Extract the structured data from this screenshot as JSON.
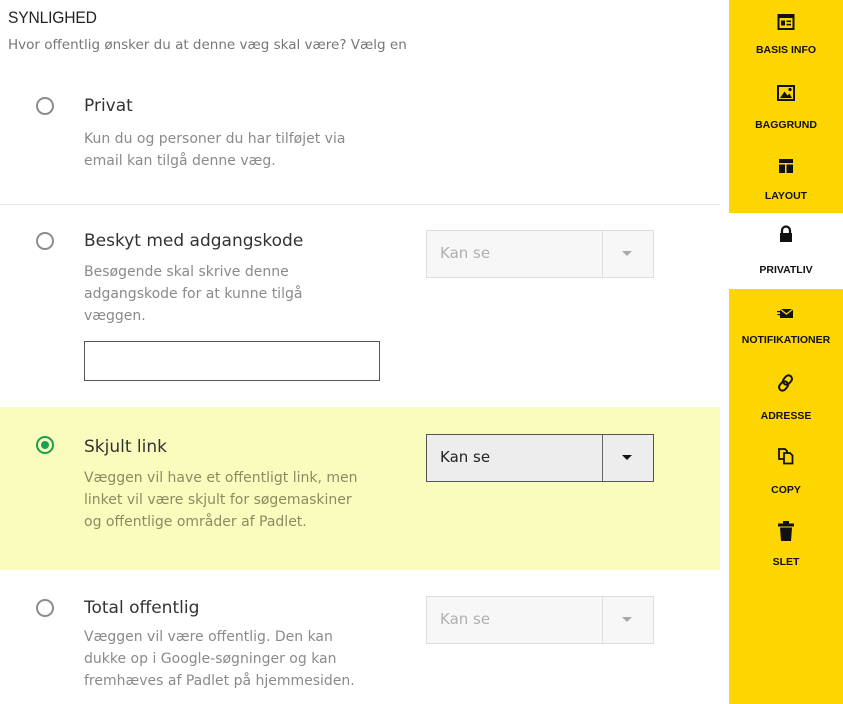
{
  "header": {
    "title": "SYNLIGHED",
    "subtitle": "Hvor offentlig ønsker du at denne væg skal være? Vælg en"
  },
  "options": [
    {
      "title": "Privat",
      "description": [
        "Kun du og personer du har tilføjet via",
        "email kan tilgå denne væg."
      ],
      "checked": false
    },
    {
      "title": "Beskyt med adgangskode",
      "description": [
        "Besøgende skal skrive denne",
        "adgangskode for at kunne tilgå",
        "væggen."
      ],
      "checked": false,
      "permission": "Kan se",
      "password_value": ""
    },
    {
      "title": "Skjult link",
      "description": [
        "Væggen vil have et offentligt link, men",
        "linket vil være skjult for søgemaskiner",
        "og offentlige områder af Padlet."
      ],
      "checked": true,
      "permission": "Kan se"
    },
    {
      "title": "Total offentlig",
      "description": [
        "Væggen vil være offentlig. Den kan",
        "dukke op i Google-søgninger og kan",
        "fremhæves af Padlet på hjemmesiden."
      ],
      "checked": false,
      "permission": "Kan se"
    }
  ],
  "sidebar": {
    "items": [
      {
        "label": "BASIS INFO",
        "icon": "info-card-icon"
      },
      {
        "label": "BAGGRUND",
        "icon": "image-icon"
      },
      {
        "label": "LAYOUT",
        "icon": "layout-icon"
      },
      {
        "label": "PRIVATLIV",
        "icon": "lock-icon",
        "active": true
      },
      {
        "label": "NOTIFIKATIONER",
        "icon": "envelope-icon"
      },
      {
        "label": "ADRESSE",
        "icon": "link-icon"
      },
      {
        "label": "COPY",
        "icon": "copy-icon"
      },
      {
        "label": "SLET",
        "icon": "trash-icon"
      }
    ]
  },
  "colors": {
    "accent_yellow": "#fdd600",
    "highlight_row": "#fafcbe",
    "radio_checked": "#1aa052"
  }
}
